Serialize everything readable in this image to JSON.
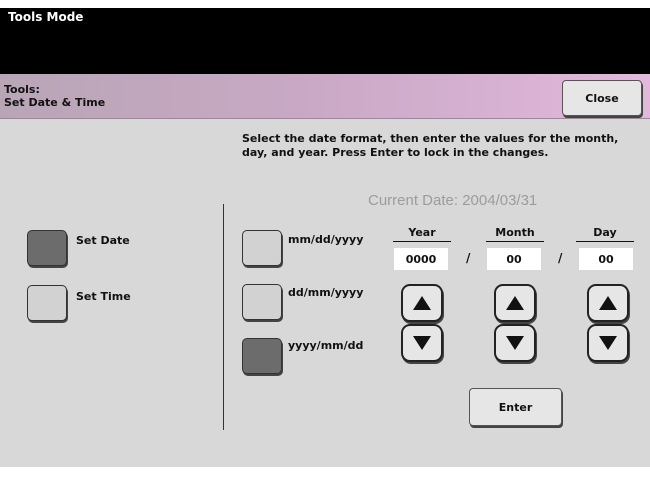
{
  "window": {
    "title": "Tools Mode"
  },
  "header": {
    "line1": "Tools:",
    "line2": "Set Date & Time",
    "close_label": "Close"
  },
  "instructions": "Select the date format, then enter the values for the month, day, and year.  Press Enter to lock in the changes.",
  "current_date": "Current Date:  2004/03/31",
  "left_options": [
    {
      "label": "Set Date",
      "selected": true
    },
    {
      "label": "Set Time",
      "selected": false
    }
  ],
  "formats": [
    {
      "label": "mm/dd/yyyy",
      "selected": false
    },
    {
      "label": "dd/mm/yyyy",
      "selected": false
    },
    {
      "label": "yyyy/mm/dd",
      "selected": true
    }
  ],
  "fields": [
    {
      "label": "Year",
      "value": "0000"
    },
    {
      "label": "Month",
      "value": "00"
    },
    {
      "label": "Day",
      "value": "00"
    }
  ],
  "separator": "/",
  "enter_label": "Enter",
  "colors": {
    "selected": "#6c6c6c",
    "unselected": "#d2d2d2",
    "header_gradient_end": "#e2b8dc"
  }
}
